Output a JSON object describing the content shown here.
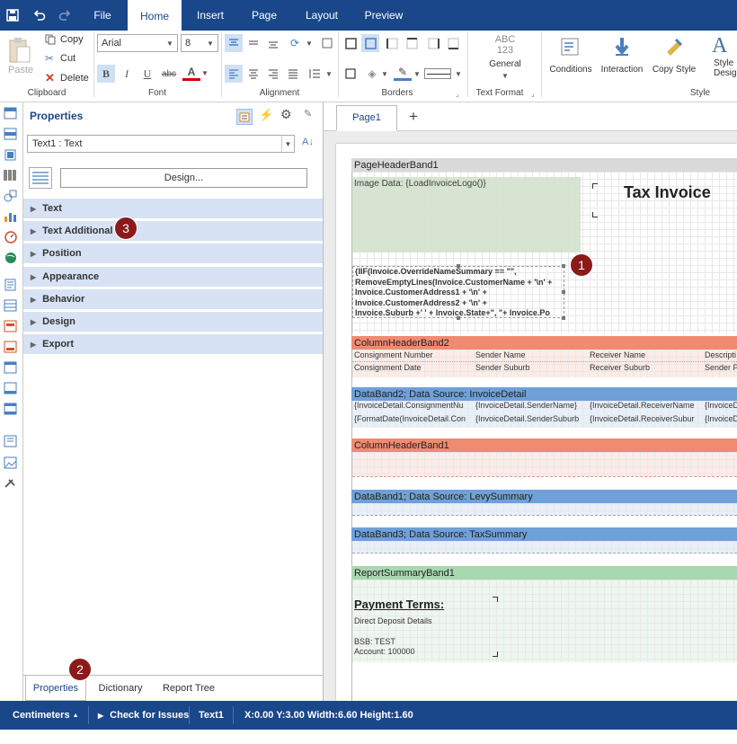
{
  "ribbon_tabs": [
    "File",
    "Home",
    "Insert",
    "Page",
    "Layout",
    "Preview"
  ],
  "clipboard": {
    "paste": "Paste",
    "copy": "Copy",
    "cut": "Cut",
    "delete": "Delete",
    "group": "Clipboard"
  },
  "font": {
    "family": "Arial",
    "size": "8",
    "group": "Font",
    "bold": "B",
    "italic": "I",
    "underline": "U",
    "strike": "abc",
    "color": "A"
  },
  "alignment": {
    "group": "Alignment"
  },
  "borders": {
    "group": "Borders"
  },
  "text_format": {
    "icon_text": "ABC\n123",
    "label": "General",
    "group": "Text Format"
  },
  "style": {
    "conditions": "Conditions",
    "interaction": "Interaction",
    "copy_style": "Copy Style",
    "style_designer": "Style Design",
    "group": "Style"
  },
  "properties": {
    "title": "Properties",
    "selector": "Text1 : Text",
    "design_button": "Design...",
    "categories": [
      "Text",
      "Text Additional",
      "Position",
      "Appearance",
      "Behavior",
      "Design",
      "Export"
    ],
    "bottom_tabs": [
      "Properties",
      "Dictionary",
      "Report Tree"
    ]
  },
  "page_tabs": {
    "page1": "Page1",
    "add": "+"
  },
  "report": {
    "page_header_band": "PageHeaderBand1",
    "image_text": "Image Data: {LoadInvoiceLogo()}",
    "title": "Tax Invoice",
    "expr_lines": [
      "{IIF(Invoice.OverrideNameSummary == \"\",",
      "RemoveEmptyLines(Invoice.CustomerName + '\\n' +",
      "Invoice.CustomerAddress1 + '\\n' +",
      "Invoice.CustomerAddress2 + '\\n' +",
      "Invoice.Suburb +' ' + Invoice.State+\", \"+ Invoice.Po"
    ],
    "column_header_band2": "ColumnHeaderBand2",
    "col_headers_row1": [
      "Consignment Number",
      "Sender Name",
      "Receiver Name",
      "Descripti"
    ],
    "col_headers_row2": [
      "Consignment Date",
      "Sender Suburb",
      "Receiver Suburb",
      "Sender P"
    ],
    "data_band2": "DataBand2; Data Source: InvoiceDetail",
    "data_row1": [
      "{InvoiceDetail.ConsignmentNu",
      "{InvoiceDetail.SenderName}",
      "{InvoiceDetail.ReceiverName",
      "{InvoiceD"
    ],
    "data_row2": [
      "{FormatDate(InvoiceDetail.Con",
      "{InvoiceDetail.SenderSuburb",
      "{InvoiceDetail.ReceiverSubur",
      "{InvoiceD"
    ],
    "column_header_band1": "ColumnHeaderBand1",
    "data_band1": "DataBand1; Data Source: LevySummary",
    "data_band3": "DataBand3; Data Source: TaxSummary",
    "report_summary_band": "ReportSummaryBand1",
    "payment_terms": "Payment Terms:",
    "direct_deposit": "Direct Deposit Details",
    "bsb": "BSB: TEST",
    "account": "Account: 100000"
  },
  "markers": [
    "1",
    "2",
    "3"
  ],
  "status": {
    "units": "Centimeters",
    "check": "Check for Issues",
    "component": "Text1",
    "coords": "X:0.00 Y:3.00 Width:6.60 Height:1.60"
  },
  "colors": {
    "brand": "#19478a",
    "page_header": "#d9d9d9",
    "column_header": "#f08a70",
    "data_band": "#6fa0d8",
    "summary": "#a8d8b0",
    "marker": "#8b1a1a"
  }
}
